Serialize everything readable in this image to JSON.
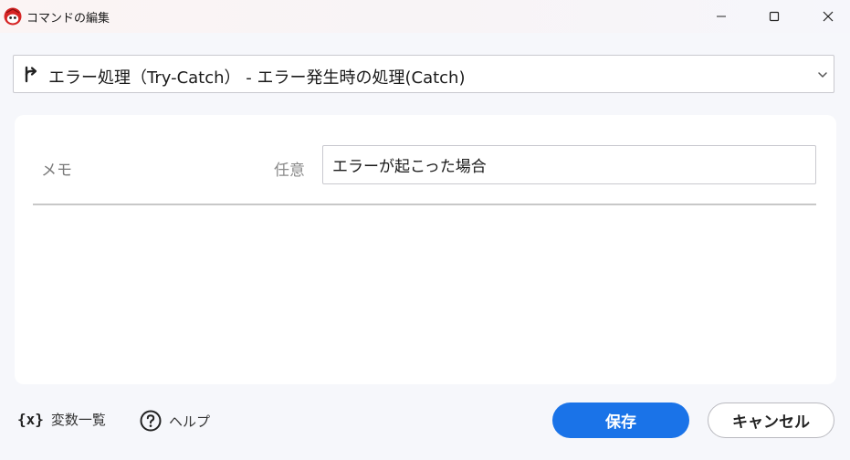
{
  "window": {
    "title": "コマンドの編集",
    "app_icon": "app-logo-icon",
    "controls": {
      "minimize_icon": "minimize-icon",
      "maximize_icon": "maximize-icon",
      "close_icon": "close-icon"
    }
  },
  "command_select": {
    "icon": "branch-arrow-icon",
    "value": "エラー処理（Try-Catch） - エラー発生時の処理(Catch)",
    "dropdown_icon": "chevron-down-icon"
  },
  "form": {
    "memo_label": "メモ",
    "optional_label": "任意",
    "memo_value": "エラーが起こった場合"
  },
  "footer": {
    "variables_glyph": "{x}",
    "variables_label": "変数一覧",
    "help_icon": "help-circle-icon",
    "help_label": "ヘルプ",
    "save_label": "保存",
    "cancel_label": "キャンセル"
  },
  "colors": {
    "primary": "#1a73e8",
    "background": "#f6f7fb",
    "card": "#ffffff",
    "border": "#c9c9cf"
  }
}
